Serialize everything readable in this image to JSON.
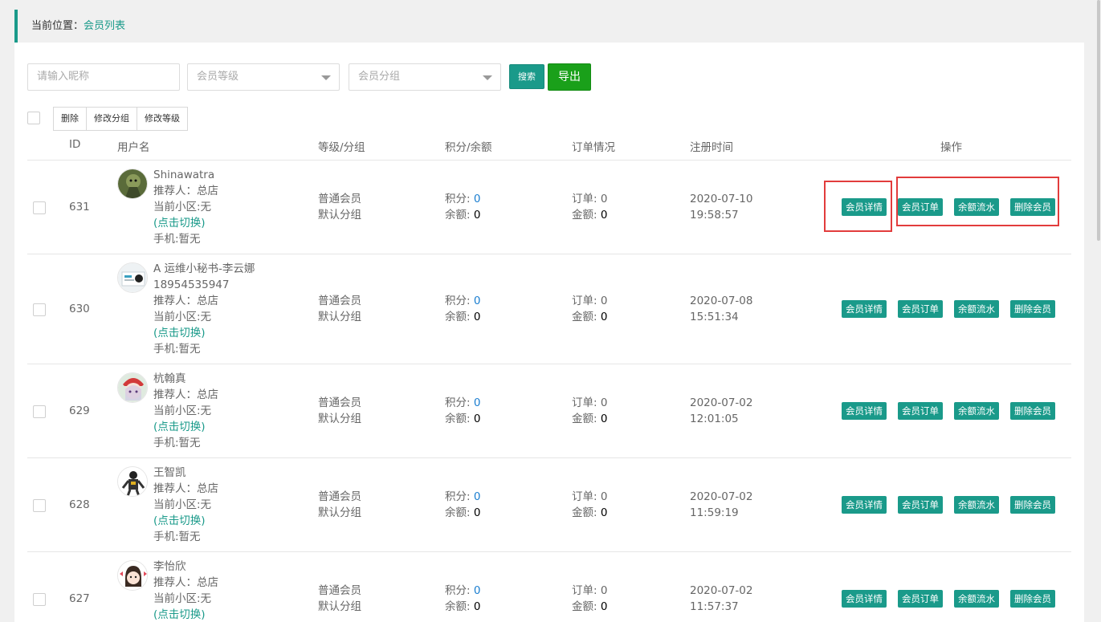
{
  "breadcrumb": {
    "prefix": "当前位置：",
    "current": "会员列表"
  },
  "filters": {
    "nickname_placeholder": "请输入昵称",
    "level_placeholder": "会员等级",
    "group_placeholder": "会员分组",
    "search_label": "搜索",
    "export_label": "导出"
  },
  "bulk_actions": {
    "delete": "删除",
    "change_group": "修改分组",
    "change_level": "修改等级"
  },
  "columns": {
    "id": "ID",
    "username": "用户名",
    "level_group": "等级/分组",
    "points_balance": "积分/余额",
    "orders": "订单情况",
    "reg_time": "注册时间",
    "actions": "操作"
  },
  "labels": {
    "referrer": "推荐人：",
    "community": "当前小区:无",
    "switch": "(点击切换)",
    "phone": "手机:暂无",
    "points": "积分: ",
    "balance": "余额: ",
    "order_count": "订单: ",
    "order_amount": "金额: ",
    "detail": "会员详情",
    "orders_btn": "会员订单",
    "flow": "余额流水",
    "delete_member": "删除会员"
  },
  "members": [
    {
      "id": "631",
      "name": "Shinawatra",
      "phone_line": "",
      "referrer": "总店",
      "level": "普通会员",
      "group": "默认分组",
      "points": "0",
      "balance": "0",
      "orders": "0",
      "amount": "0",
      "date": "2020-07-10",
      "time": "19:58:57",
      "avatar_icon": "dragon-avatar"
    },
    {
      "id": "630",
      "name": "A 运维小秘书-李云娜",
      "phone_line": "18954535947",
      "referrer": "总店",
      "level": "普通会员",
      "group": "默认分组",
      "points": "0",
      "balance": "0",
      "orders": "0",
      "amount": "0",
      "date": "2020-07-08",
      "time": "15:51:34",
      "avatar_icon": "card-avatar"
    },
    {
      "id": "629",
      "name": "杭翰真",
      "phone_line": "",
      "referrer": "总店",
      "level": "普通会员",
      "group": "默认分组",
      "points": "0",
      "balance": "0",
      "orders": "0",
      "amount": "0",
      "date": "2020-07-02",
      "time": "12:01:05",
      "avatar_icon": "anime-girl-avatar"
    },
    {
      "id": "628",
      "name": "王智凯",
      "phone_line": "",
      "referrer": "总店",
      "level": "普通会员",
      "group": "默认分组",
      "points": "0",
      "balance": "0",
      "orders": "0",
      "amount": "0",
      "date": "2020-07-02",
      "time": "11:59:19",
      "avatar_icon": "robot-avatar"
    },
    {
      "id": "627",
      "name": "李怡欣",
      "phone_line": "",
      "referrer": "总店",
      "level": "普通会员",
      "group": "默认分组",
      "points": "0",
      "balance": "0",
      "orders": "0",
      "amount": "0",
      "date": "2020-07-02",
      "time": "11:57:37",
      "avatar_icon": "cartoon-girl-avatar"
    }
  ],
  "colors": {
    "accent": "#1a9a8a",
    "export": "#1aa01a",
    "highlight": "#e23c3c",
    "link": "#1a7ed0"
  }
}
